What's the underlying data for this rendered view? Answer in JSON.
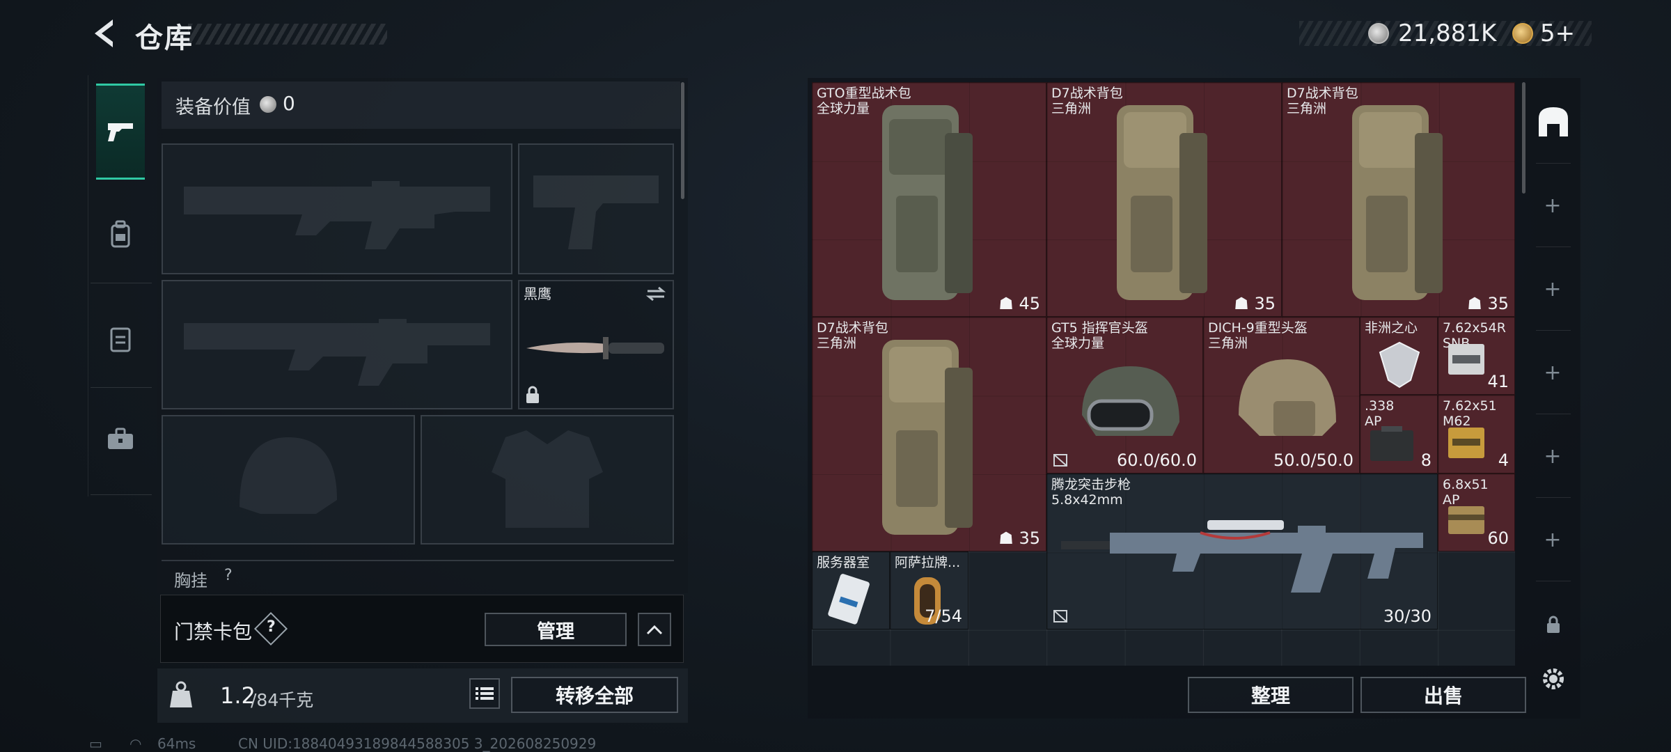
{
  "header": {
    "title": "仓库",
    "currency_1": "21,881K",
    "currency_2": "5+"
  },
  "equipment": {
    "value_label": "装备价值",
    "value": "0",
    "melee_name": "黑鹰",
    "chest_rig_label": "胸挂",
    "chest_rig_count": "?"
  },
  "keycard": {
    "label": "门禁卡包",
    "help": "?",
    "manage_label": "管理"
  },
  "weight": {
    "current": "1.2",
    "max": "/84千克",
    "transfer_all_label": "转移全部"
  },
  "inventory": {
    "items": [
      {
        "name": "GTO重型战术包",
        "sub": "全球力量",
        "count": "45"
      },
      {
        "name": "D7战术背包",
        "sub": "三角洲",
        "count": "35"
      },
      {
        "name": "D7战术背包",
        "sub": "三角洲",
        "count": "35"
      },
      {
        "name": "D7战术背包",
        "sub": "三角洲",
        "count": "35"
      },
      {
        "name": "GT5 指挥官头盔",
        "sub": "全球力量",
        "count": "60.0/60.0"
      },
      {
        "name": "DICH-9重型头盔",
        "sub": "三角洲",
        "count": "50.0/50.0"
      },
      {
        "name": "非洲之心",
        "sub": "",
        "count": ""
      },
      {
        "name": "7.62x54R",
        "sub": "SNB",
        "count": "41"
      },
      {
        "name": ".338",
        "sub": "AP",
        "count": "8"
      },
      {
        "name": "7.62x51",
        "sub": "M62",
        "count": "4"
      },
      {
        "name": "腾龙突击步枪",
        "sub": "5.8x42mm",
        "count": "30/30"
      },
      {
        "name": "6.8x51",
        "sub": "AP",
        "count": "60"
      },
      {
        "name": "服务器室",
        "sub": "",
        "count": ""
      },
      {
        "name": "阿萨拉牌...",
        "sub": "",
        "count": "7/54"
      }
    ],
    "organize_label": "整理",
    "sell_label": "出售"
  },
  "status": {
    "ping": "64ms",
    "uid": "CN UID:18840493189844588305 3_202608250929"
  },
  "colors": {
    "accent": "#30c9a4",
    "item_red": "#5c242c",
    "bg": "#141b22"
  }
}
